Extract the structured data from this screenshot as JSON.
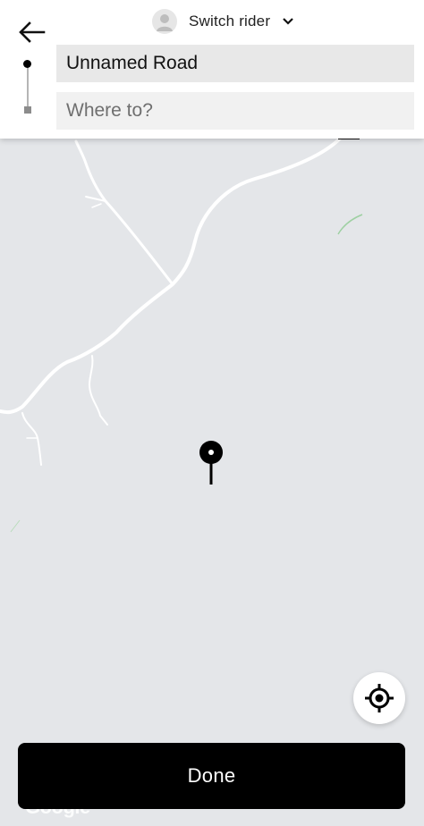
{
  "header": {
    "back_icon": "arrow-left-icon",
    "switch_rider_label": "Switch rider",
    "avatar_icon": "person-icon",
    "chevron_icon": "chevron-down-icon"
  },
  "route": {
    "origin_value": "Unnamed Road",
    "destination_placeholder": "Where to?"
  },
  "map": {
    "marker_icon": "map-pin-icon",
    "locate_icon": "crosshair-icon",
    "attribution": "Google"
  },
  "footer": {
    "done_label": "Done"
  },
  "colors": {
    "map_background": "#e4e6e9",
    "road": "#ffffff",
    "accent": "#000000"
  }
}
